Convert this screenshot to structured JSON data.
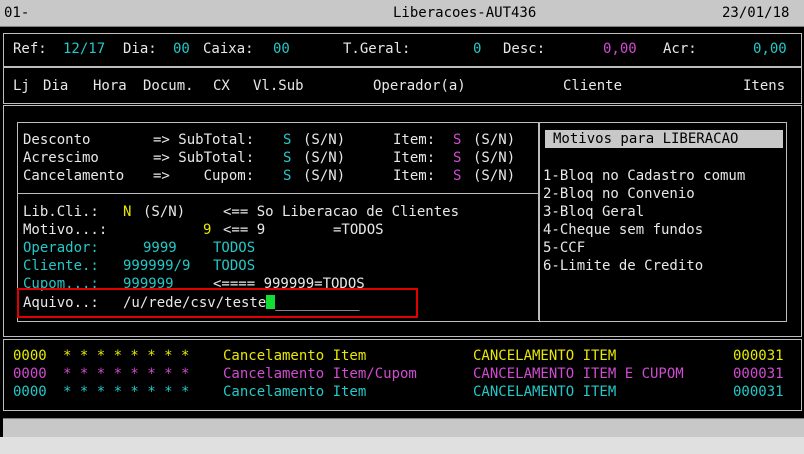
{
  "title": {
    "session": "01-",
    "program": "Liberacoes-AUT436",
    "date": "23/01/18"
  },
  "summary": {
    "ref_label": "Ref:",
    "ref_value": "12/17",
    "dia_label": "Dia:",
    "dia_value": "00",
    "caixa_label": "Caixa:",
    "caixa_value": "00",
    "tgeral_label": "T.Geral:",
    "tgeral_value": "0",
    "desc_label": "Desc:",
    "desc_value": "0,00",
    "acr_label": "Acr:",
    "acr_value": "0,00"
  },
  "columns": {
    "lj": "Lj",
    "dia": "Dia",
    "hora": "Hora",
    "docum": "Docum.",
    "cx": "CX",
    "vlsub": "Vl.Sub",
    "operador": "Operador(a)",
    "cliente": "Cliente",
    "itens": "Itens"
  },
  "options": [
    {
      "name": "Desconto",
      "arrow": "=> SubTotal:",
      "sub_value": "S",
      "sub_hint": "(S/N)",
      "item_label": "Item:",
      "item_value": "S",
      "item_hint": "(S/N)"
    },
    {
      "name": "Acrescimo",
      "arrow": "=> SubTotal:",
      "sub_value": "S",
      "sub_hint": "(S/N)",
      "item_label": "Item:",
      "item_value": "S",
      "item_hint": "(S/N)"
    },
    {
      "name": "Cancelamento",
      "arrow": "=>    Cupom:",
      "sub_value": "S",
      "sub_hint": "(S/N)",
      "item_label": "Item:",
      "item_value": "S",
      "item_hint": "(S/N)"
    }
  ],
  "filters": {
    "libcli_label": "Lib.Cli.:",
    "libcli_value": "N",
    "libcli_hint": "(S/N)",
    "libcli_note": "<== So Liberacao de Clientes",
    "motivo_label": "Motivo...:",
    "motivo_value": "9",
    "motivo_note": "<== 9",
    "motivo_note2": "=TODOS",
    "operador_label": "Operador:",
    "operador_value": "9999",
    "operador_note": "TODOS",
    "cliente_label": "Cliente.:",
    "cliente_value": "999999/9",
    "cliente_note": "TODOS",
    "cupom_label": "Cupom...:",
    "cupom_value": "999999",
    "cupom_note": "<==== 999999=TODOS",
    "arquivo_label": "Aquivo..:",
    "arquivo_value": "/u/rede/csv/teste"
  },
  "motivos": {
    "title": "Motivos para LIBERACAO",
    "items": [
      "1-Bloq no Cadastro comum",
      "2-Bloq no Convenio",
      "3-Bloq Geral",
      "4-Cheque sem fundos",
      "5-CCF",
      "6-Limite de Credito"
    ]
  },
  "log": [
    {
      "code": "0000",
      "stars": "* * * * * * * *",
      "desc": "Cancelamento Item",
      "type": "CANCELAMENTO ITEM",
      "num": "000031"
    },
    {
      "code": "0000",
      "stars": "* * * * * * * *",
      "desc": "Cancelamento Item/Cupom",
      "type": "CANCELAMENTO ITEM E CUPOM",
      "num": "000031"
    },
    {
      "code": "0000",
      "stars": "* * * * * * * *",
      "desc": "Cancelamento Item",
      "type": "CANCELAMENTO ITEM",
      "num": "000031"
    }
  ],
  "colors": {
    "cyan": "#24c8c8",
    "magenta": "#d04cd0",
    "yellow": "#e8e800",
    "green": "#2fd45a",
    "highlight_border": "#e00000"
  }
}
